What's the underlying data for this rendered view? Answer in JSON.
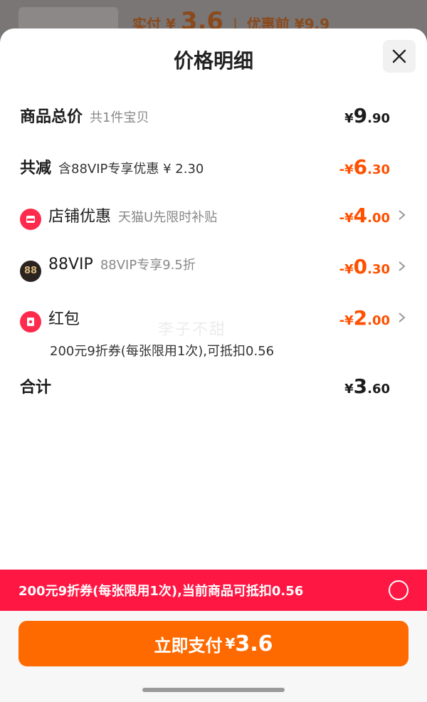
{
  "background": {
    "paid_label": "实付",
    "paid_currency": "¥",
    "paid_value": "3.6",
    "before_label": "优惠前",
    "before_value": "¥9.9"
  },
  "sheet": {
    "title": "价格明细",
    "close_icon": "close-icon"
  },
  "rows": {
    "total": {
      "label": "商品总价",
      "sub": "共1件宝贝",
      "currency": "¥",
      "int": "9",
      "dec": ".90"
    },
    "discount_total": {
      "label": "共减",
      "sub": "含88VIP专享优惠 ¥ 2.30",
      "currency": "-¥",
      "int": "6",
      "dec": ".30"
    },
    "store": {
      "icon": "store-icon",
      "label": "店铺优惠",
      "sub": "天猫U先限时补贴",
      "currency": "-¥",
      "int": "4",
      "dec": ".00"
    },
    "vip": {
      "icon": "88vip-icon",
      "icon_text": "88",
      "label": "88VIP",
      "sub": "88VIP专享9.5折",
      "currency": "-¥",
      "int": "0",
      "dec": ".30"
    },
    "red_packet": {
      "icon": "red-packet-icon",
      "label": "红包",
      "desc": "200元9折券(每张限用1次),可抵扣0.56",
      "currency": "-¥",
      "int": "2",
      "dec": ".00"
    },
    "sum": {
      "label": "合计",
      "currency": "¥",
      "int": "3",
      "dec": ".60"
    }
  },
  "watermark": "李子不甜",
  "banner": {
    "text": "200元9折券(每张限用1次),当前商品可抵扣0.56"
  },
  "pay_button": {
    "label": "立即支付",
    "currency": "¥",
    "value": "3.6"
  },
  "colors": {
    "accent_orange": "#ff5000",
    "button_orange": "#ff6a00",
    "banner_red": "#ff1744",
    "icon_red": "#ff2b4c"
  }
}
